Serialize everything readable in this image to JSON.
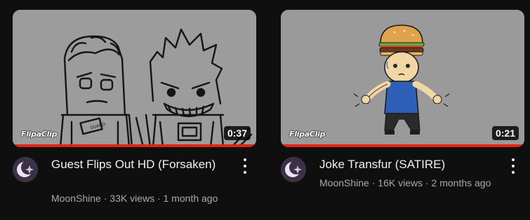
{
  "videos": [
    {
      "title": "Guest Flips Out HD (Forsaken)",
      "channel": "MoonShine",
      "views": "33K views",
      "age": "1 month ago",
      "separator": " · ",
      "duration": "0:37",
      "watched_fraction": 1.0,
      "watermark": "FlipaClip",
      "thumbnail_icon": "sketch-two-characters",
      "avatar_icon": "crescent-moon-sparkle-icon",
      "menu_icon": "more-vert-icon"
    },
    {
      "title": "Joke Transfur (SATIRE)",
      "channel": "MoonShine",
      "views": "16K views",
      "age": "2 months ago",
      "separator": " · ",
      "duration": "0:21",
      "watched_fraction": 1.0,
      "watermark": "FlipaClip",
      "thumbnail_icon": "burger-head-character",
      "avatar_icon": "crescent-moon-sparkle-icon",
      "menu_icon": "more-vert-icon"
    }
  ],
  "colors": {
    "background": "#0f0f0f",
    "progress": "#e62117",
    "title": "#f1f1f1",
    "meta": "#aaaaaa"
  }
}
